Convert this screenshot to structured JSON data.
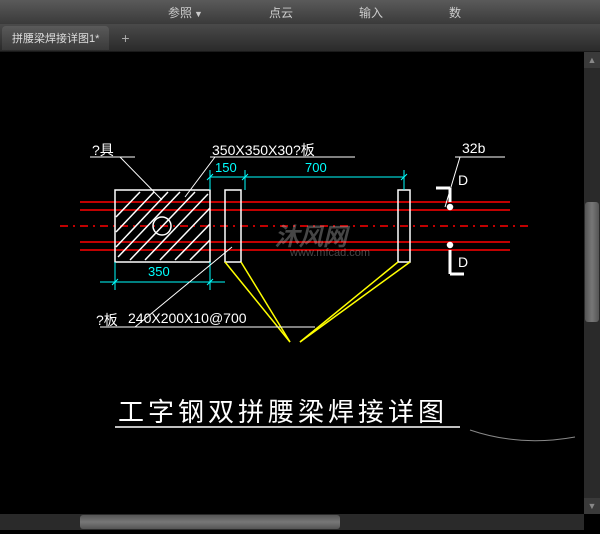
{
  "menubar": {
    "items": [
      "参照",
      "点云",
      "输入",
      "数"
    ]
  },
  "tabbar": {
    "active_tab": "拼腰梁焊接详图1*",
    "add_label": "+"
  },
  "labels": {
    "fixture": "?具",
    "plate_spec": "350X350X30?板",
    "dim_150": "150",
    "dim_700": "700",
    "dim_350": "350",
    "section_top": "D",
    "section_bot": "D",
    "beam_spec": "32b",
    "bottom_plate_label": "?板",
    "bottom_plate_spec": "240X200X10@700"
  },
  "title": "工字钢双拼腰梁焊接详图",
  "watermark": {
    "brand": "沐风网",
    "url": "www.mfcad.com"
  }
}
